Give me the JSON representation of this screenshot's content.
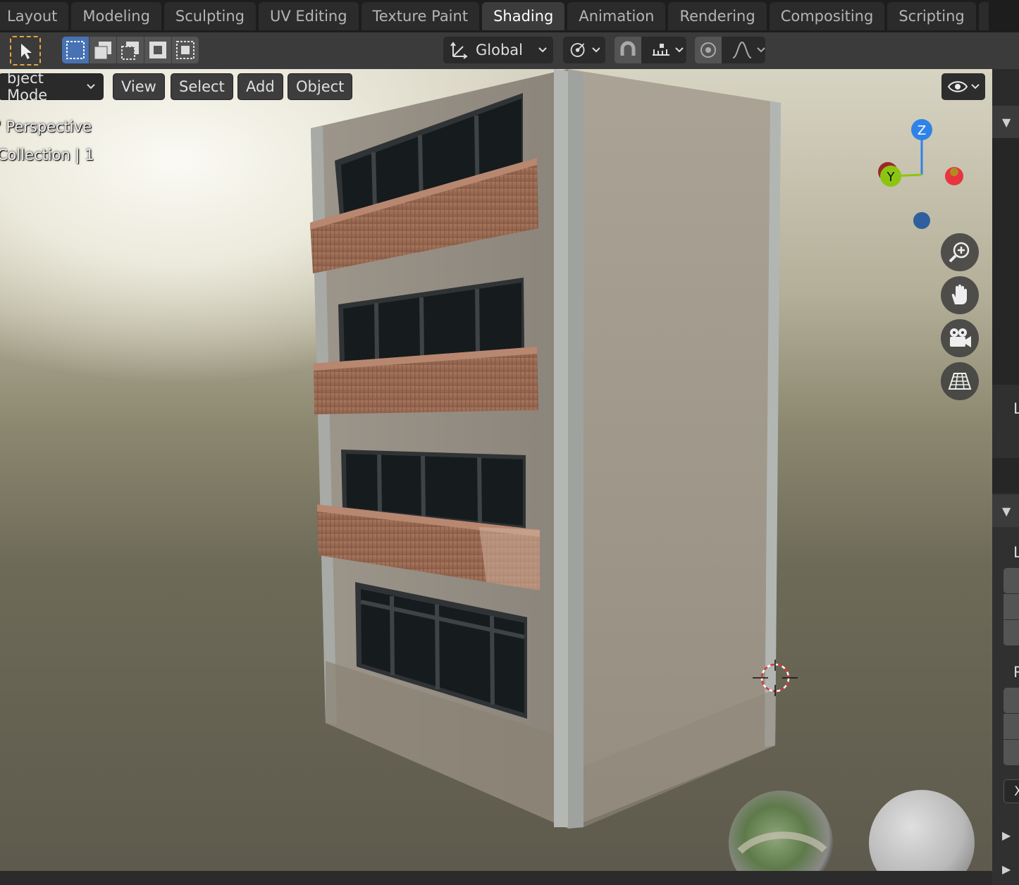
{
  "workspace_tabs": [
    "Layout",
    "Modeling",
    "Sculpting",
    "UV Editing",
    "Texture Paint",
    "Shading",
    "Animation",
    "Rendering",
    "Compositing",
    "Scripting"
  ],
  "active_tab": "Shading",
  "tool_header": {
    "transform_orientation": "Global"
  },
  "viewport_header": {
    "mode": "bject Mode",
    "menus": [
      "View",
      "Select",
      "Add",
      "Object"
    ]
  },
  "viewport_overlay": {
    "view_name": "' Perspective",
    "collection_info": "Collection | 1"
  },
  "axis_gizmo": {
    "z_label": "Z",
    "y_label": "Y",
    "z_color": "#2f83e8",
    "y_color": "#8cc511",
    "x_color": "#e8343f"
  },
  "nav_buttons": [
    "zoom-icon",
    "pan-hand-icon",
    "camera-icon",
    "grid-perspective-icon"
  ],
  "npanel": {
    "letters": [
      "L",
      "L",
      "R"
    ],
    "x_label": "X"
  },
  "colors": {
    "accent_blue": "#4772b3",
    "active_tool_outline": "#e8a33d",
    "header_bg": "#3b3b3b",
    "tabbar_bg": "#1d1d1d"
  }
}
